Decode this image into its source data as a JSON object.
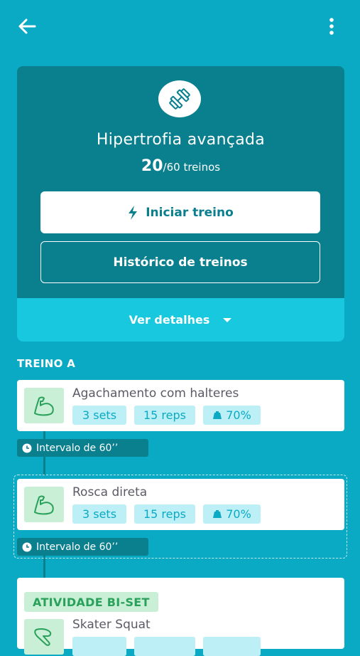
{
  "colors": {
    "background": "#0aaac5",
    "hero": "#0a7f8e",
    "details_bar": "#18c8df",
    "chip_bg": "#bdeff6",
    "chip_text": "#0aaac5",
    "green_bg": "#c9f0d6",
    "green_text": "#2aa15a"
  },
  "header": {
    "back_icon": "arrow-left-icon",
    "menu_icon": "more-vertical-icon"
  },
  "program": {
    "icon": "dumbbell-icon",
    "title": "Hipertrofia avançada",
    "completed": "20",
    "total_label": "/60 treinos",
    "start_button": "Iniciar treino",
    "history_button": "Histórico de treinos",
    "details_label": "Ver detalhes"
  },
  "section": {
    "title": "TREINO A"
  },
  "exercises": [
    {
      "name": "Agachamento com halteres",
      "sets": "3 sets",
      "reps": "15 reps",
      "load": "70%",
      "icon": "muscle-arm-icon"
    },
    {
      "name": "Rosca direta",
      "sets": "3 sets",
      "reps": "15 reps",
      "load": "70%",
      "icon": "muscle-arm-icon"
    },
    {
      "name": "Skater Squat",
      "icon": "leg-icon"
    }
  ],
  "intervals": [
    "Intervalo de 60’’",
    "Intervalo de 60’’"
  ],
  "biset": {
    "label": "ATIVIDADE BI-SET"
  }
}
